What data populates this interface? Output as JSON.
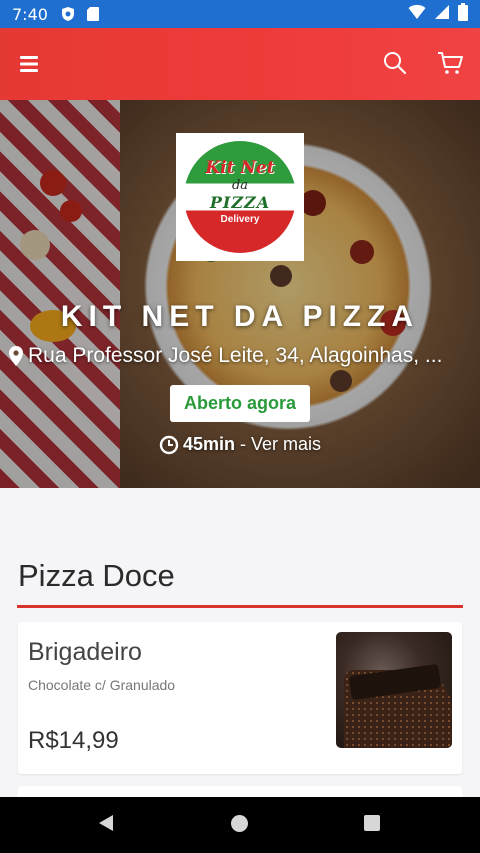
{
  "status_bar": {
    "time": "7:40",
    "left_icons": [
      "shield-icon",
      "sd-card-icon"
    ],
    "right_icons": [
      "wifi-icon",
      "signal-icon",
      "battery-icon"
    ],
    "color": "#1f6fd0"
  },
  "app_bar": {
    "color": "#e53935",
    "icons": [
      "menu-icon",
      "search-icon",
      "cart-icon"
    ]
  },
  "hero": {
    "logo": {
      "line1": "Kit Net",
      "line2": "da",
      "line3": "PIZZA",
      "line4": "Delivery"
    },
    "title": "KIT NET DA PIZZA",
    "address": "Rua Professor José Leite, 34, Alagoinhas, ...",
    "status_badge": "Aberto agora",
    "delivery_time": "45min",
    "separator": "-",
    "more_link": "Ver mais",
    "accent_green": "#2a9a3a"
  },
  "section": {
    "title": "Pizza Doce",
    "underline_color": "#d9342b"
  },
  "products": [
    {
      "name": "Brigadeiro",
      "description": "Chocolate c/ Granulado",
      "price": "R$14,99"
    }
  ]
}
